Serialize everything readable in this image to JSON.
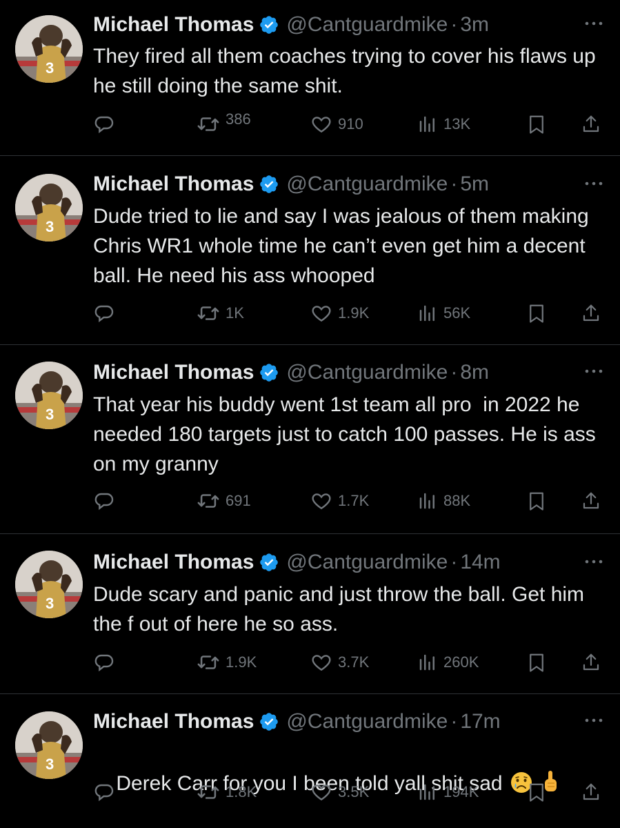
{
  "colors": {
    "background": "#000000",
    "text": "#e7e9ea",
    "secondary": "#71767b",
    "divider": "#2f3336",
    "verified": "#1d9bf0"
  },
  "tweets": [
    {
      "name": "Michael Thomas",
      "handle": "@Cantguardmike",
      "dot": "·",
      "time": "3m",
      "text": "They fired all them coaches trying to cover his flaws up he still doing the same shit.",
      "reposts": "386",
      "likes": "910",
      "views": "13K"
    },
    {
      "name": "Michael Thomas",
      "handle": "@Cantguardmike",
      "dot": "·",
      "time": "5m",
      "text": "Dude tried to lie and say I was jealous of them making Chris WR1 whole time he can’t even get him a decent ball. He need his ass whooped",
      "reposts": "1K",
      "likes": "1.9K",
      "views": "56K"
    },
    {
      "name": "Michael Thomas",
      "handle": "@Cantguardmike",
      "dot": "·",
      "time": "8m",
      "text": "That year his buddy went 1st team all pro  in 2022 he needed 180 targets just to catch 100 passes. He is ass on my granny",
      "reposts": "691",
      "likes": "1.7K",
      "views": "88K"
    },
    {
      "name": "Michael Thomas",
      "handle": "@Cantguardmike",
      "dot": "·",
      "time": "14m",
      "text": "Dude scary and panic and just throw the ball. Get him the f out of here he so ass.",
      "reposts": "1.9K",
      "likes": "3.7K",
      "views": "260K"
    },
    {
      "name": "Michael Thomas",
      "handle": "@Cantguardmike",
      "dot": "·",
      "time": "17m",
      "text": "Derek Carr for you I been told yall shit sad",
      "emoji": [
        "crying-face",
        "backhand-index-pointing-up"
      ],
      "reposts": "1.8K",
      "likes": "3.5K",
      "views": "194K"
    }
  ]
}
